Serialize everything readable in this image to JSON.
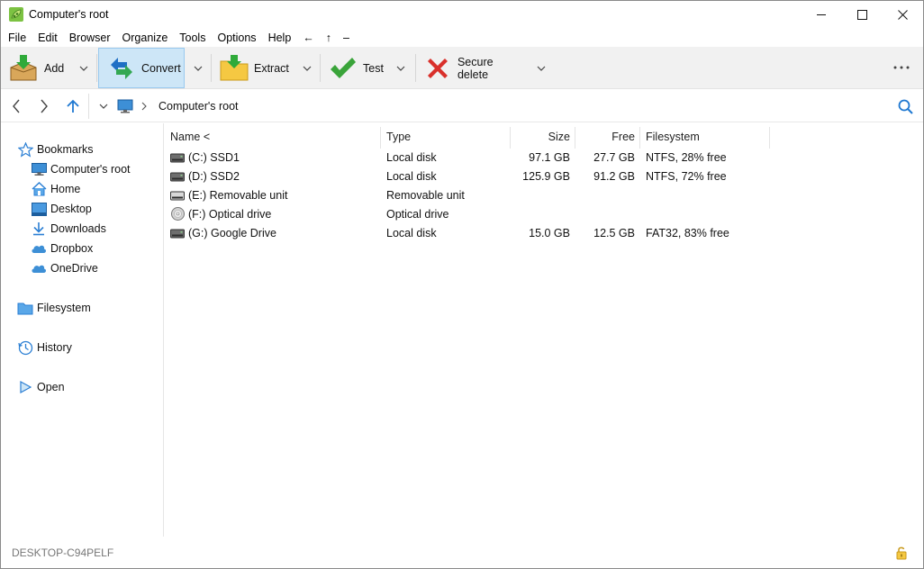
{
  "window": {
    "title": "Computer's root",
    "controls": [
      "minimize-icon",
      "maximize-icon",
      "close-icon"
    ]
  },
  "menu": {
    "items": [
      "File",
      "Edit",
      "Browser",
      "Organize",
      "Tools",
      "Options",
      "Help",
      "←",
      "↑",
      "–"
    ]
  },
  "toolbar": {
    "add_label": "Add",
    "convert_label": "Convert",
    "extract_label": "Extract",
    "test_label": "Test",
    "secure_delete_label": "Secure delete",
    "more_icon": "more-horizontal-icon"
  },
  "address": {
    "path": "Computer's root",
    "location_icon": "monitor-icon"
  },
  "sidebar": {
    "bookmarks_label": "Bookmarks",
    "items": [
      {
        "label": "Computer's root",
        "icon": "monitor-icon"
      },
      {
        "label": "Home",
        "icon": "home-icon"
      },
      {
        "label": "Desktop",
        "icon": "desktop-icon"
      },
      {
        "label": "Downloads",
        "icon": "download-icon"
      },
      {
        "label": "Dropbox",
        "icon": "cloud-icon"
      },
      {
        "label": "OneDrive",
        "icon": "cloud-icon"
      }
    ],
    "filesystem_label": "Filesystem",
    "history_label": "History",
    "open_label": "Open"
  },
  "filelist": {
    "columns": [
      "Name <",
      "Type",
      "Size",
      "Free",
      "Filesystem"
    ],
    "rows": [
      {
        "name": "(C:) SSD1",
        "type": "Local disk",
        "size": "97.1 GB",
        "free": "27.7 GB",
        "fs": "NTFS, 28% free",
        "icon": "hard-drive-icon"
      },
      {
        "name": "(D:) SSD2",
        "type": "Local disk",
        "size": "125.9 GB",
        "free": "91.2 GB",
        "fs": "NTFS, 72% free",
        "icon": "hard-drive-icon"
      },
      {
        "name": "(E:) Removable unit",
        "type": "Removable unit",
        "size": "",
        "free": "",
        "fs": "",
        "icon": "removable-drive-icon"
      },
      {
        "name": "(F:) Optical drive",
        "type": "Optical drive",
        "size": "",
        "free": "",
        "fs": "",
        "icon": "optical-disc-icon"
      },
      {
        "name": "(G:) Google Drive",
        "type": "Local disk",
        "size": "15.0 GB",
        "free": "12.5 GB",
        "fs": "FAT32, 83% free",
        "icon": "hard-drive-icon"
      }
    ]
  },
  "status": {
    "computer_name": "DESKTOP-C94PELF"
  },
  "colors": {
    "accent": "#0078d7",
    "active_button": "#cde6f7",
    "toolbar_bg": "#f1f1f1",
    "test_check": "#3aa43a",
    "delete_x": "#d9302b",
    "folder": "#f5c842"
  }
}
